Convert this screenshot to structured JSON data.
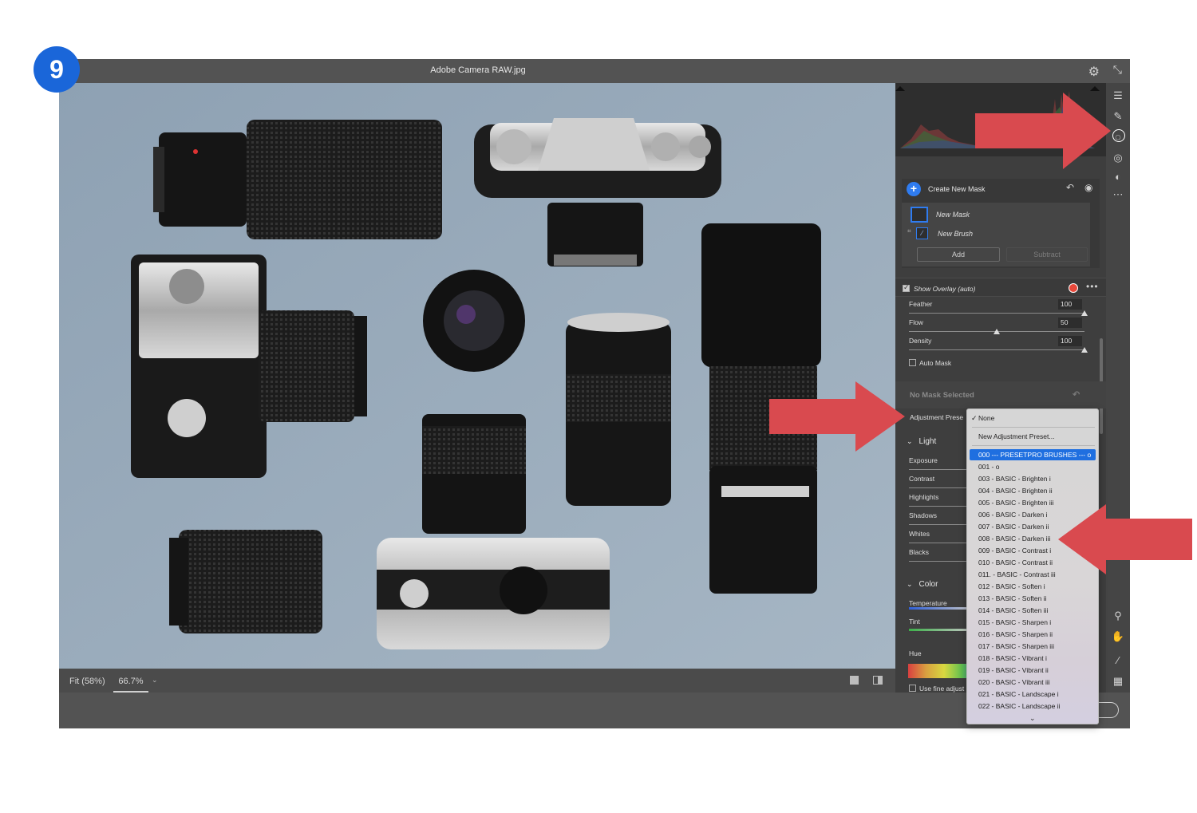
{
  "step": {
    "number": "9"
  },
  "window": {
    "title": "Adobe Camera RAW.jpg"
  },
  "statusbar": {
    "fit": "Fit (58%)",
    "zoom": "66.7%"
  },
  "masks": {
    "create_label": "Create New Mask",
    "new_mask": "New Mask",
    "new_brush": "New Brush",
    "add": "Add",
    "subtract": "Subtract",
    "show_overlay": "Show Overlay (auto)"
  },
  "brush": {
    "sliders": [
      {
        "label": "Feather",
        "value": "100",
        "fraction": 1.0
      },
      {
        "label": "Flow",
        "value": "50",
        "fraction": 0.5
      },
      {
        "label": "Density",
        "value": "100",
        "fraction": 1.0
      }
    ],
    "auto_mask": "Auto Mask"
  },
  "panel": {
    "no_mask": "No Mask Selected",
    "adjustment_preset": "Adjustment Prese",
    "light_label": "Light",
    "light_items": [
      "Exposure",
      "Contrast",
      "Highlights",
      "Shadows",
      "Whites",
      "Blacks"
    ],
    "color_label": "Color",
    "color_items": {
      "temperature": "Temperature",
      "tint": "Tint",
      "hue": "Hue"
    },
    "fine_adjust": "Use fine adjust"
  },
  "dropdown": {
    "none": "None",
    "new_preset": "New Adjustment Preset...",
    "selected": "000 --- PRESETPRO BRUSHES --- o",
    "items": [
      "001 - o",
      "003 - BASIC - Brighten i",
      "004 - BASIC - Brighten ii",
      "005 - BASIC - Brighten iii",
      "006 - BASIC - Darken i",
      "007 - BASIC - Darken ii",
      "008 - BASIC - Darken iii",
      "009 - BASIC - Contrast i",
      "010 - BASIC - Contrast ii",
      "011. - BASIC - Contrast iii",
      "012 - BASIC - Soften i",
      "013 - BASIC - Soften ii",
      "014 - BASIC - Soften iii",
      "015 - BASIC - Sharpen i",
      "016 - BASIC - Sharpen ii",
      "017 - BASIC - Sharpen iii",
      "018 - BASIC - Vibrant i",
      "019 - BASIC - Vibrant ii",
      "020 - BASIC - Vibrant iii",
      "021 - BASIC - Landscape i",
      "022 - BASIC - Landscape ii"
    ]
  },
  "icons": {
    "gear": "gear-icon",
    "shrink": "shrink-icon",
    "tools": [
      "edit-sliders-icon",
      "healing-brush-icon",
      "masking-icon",
      "red-eye-icon",
      "presets-icon",
      "more-icon",
      "zoom-icon",
      "hand-icon",
      "color-sampler-icon",
      "grid-icon"
    ]
  },
  "colors": {
    "accent": "#2f7cf0",
    "arrow": "#d94a4f",
    "step_badge": "#1a66d9",
    "overlay_dot": "#e8483a"
  }
}
